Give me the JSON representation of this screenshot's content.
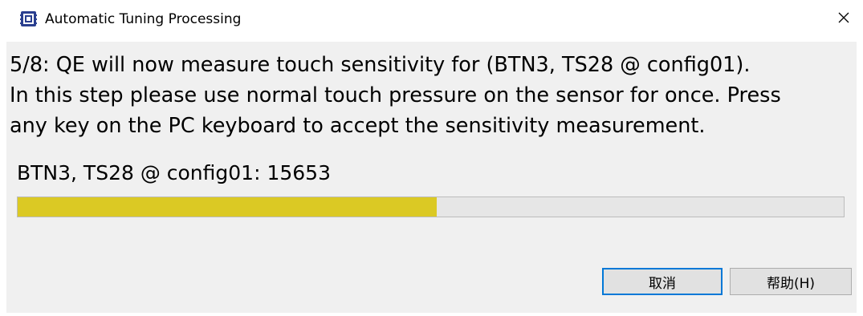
{
  "window": {
    "title": "Automatic Tuning Processing",
    "icon": "qe-app-icon",
    "close_icon": "close-icon"
  },
  "message": {
    "lines": [
      "5/8: QE will now measure touch sensitivity for (BTN3, TS28 @ config01).",
      "In this step please use normal touch pressure on the sensor for once. Press",
      "any key on the PC keyboard to accept the sensitivity measurement."
    ]
  },
  "measurement": {
    "label": "BTN3, TS28 @ config01: 15653",
    "progress_fraction": 0.507,
    "progress_color": "#dbc924"
  },
  "buttons": {
    "cancel_label": "取消",
    "help_label": "帮助(H)"
  }
}
